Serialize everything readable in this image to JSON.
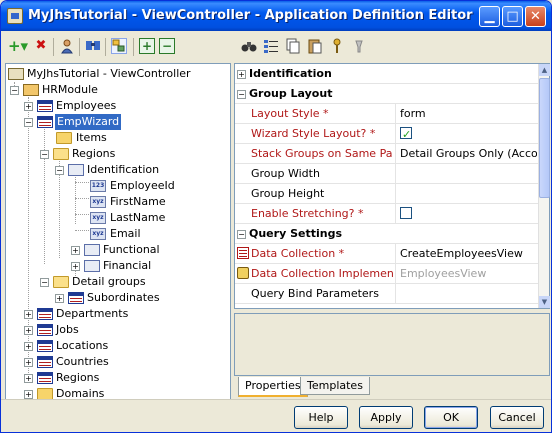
{
  "window": {
    "title": "MyJhsTutorial - ViewController - Application Definition Editor",
    "min_glyph": "▁",
    "max_glyph": "□",
    "close_glyph": "✕"
  },
  "left_toolbar": {
    "icons": [
      "add-icon",
      "delete-icon",
      "user-icon",
      "find-icon",
      "refresh-icon",
      "expand-all-icon",
      "collapse-all-icon"
    ],
    "glyphs": {
      "add": "+▾",
      "delete": "✖",
      "expand": "+",
      "collapse": "−"
    }
  },
  "tree": {
    "root": "MyJhsTutorial - ViewController",
    "module": "HRModule",
    "employees": "Employees",
    "empwizard": "EmpWizard",
    "items": "Items",
    "regions": "Regions",
    "identification": "Identification",
    "fields": [
      "EmployeeId",
      "FirstName",
      "LastName",
      "Email"
    ],
    "functional": "Functional",
    "financial": "Financial",
    "detail_groups": "Detail groups",
    "subordinates": "Subordinates",
    "departments": "Departments",
    "jobs": "Jobs",
    "locations": "Locations",
    "countries": "Countries",
    "regions2": "Regions",
    "domains": "Domains",
    "field_badges": [
      "123",
      "xyz",
      "xyz",
      "xyz"
    ]
  },
  "right_toolbar": {
    "icons": [
      "binoculars-icon",
      "categorized-icon",
      "copy-icon",
      "paste-icon",
      "pin-icon",
      "filter-icon"
    ]
  },
  "properties": {
    "sections": {
      "identification": "Identification",
      "group_layout": "Group Layout",
      "query_settings": "Query Settings"
    },
    "section_glyphs": {
      "collapsed": "+",
      "expanded": "−"
    },
    "rows": {
      "layout_style": {
        "name": "Layout Style *",
        "value": "form"
      },
      "wizard_style": {
        "name": "Wizard Style Layout? *",
        "checked": true
      },
      "stack_groups": {
        "name": "Stack Groups on Same Page *",
        "value": "Detail Groups Only (Accordion)"
      },
      "group_width": {
        "name": "Group Width",
        "value": ""
      },
      "group_height": {
        "name": "Group Height",
        "value": ""
      },
      "enable_stretching": {
        "name": "Enable Stretching? *",
        "checked": false
      },
      "data_collection": {
        "name": "Data Collection *",
        "value": "CreateEmployeesView"
      },
      "data_collection_impl": {
        "name": "Data Collection Implement...",
        "value": "EmployeesView"
      },
      "query_bind": {
        "name": "Query Bind Parameters",
        "value": ""
      }
    }
  },
  "scrollbar": {
    "up": "▲",
    "down": "▼"
  },
  "tabs": [
    {
      "label": "Properties",
      "active": true
    },
    {
      "label": "Templates",
      "active": false
    }
  ],
  "buttons": {
    "help": "Help",
    "apply": "Apply",
    "ok": "OK",
    "cancel": "Cancel"
  }
}
